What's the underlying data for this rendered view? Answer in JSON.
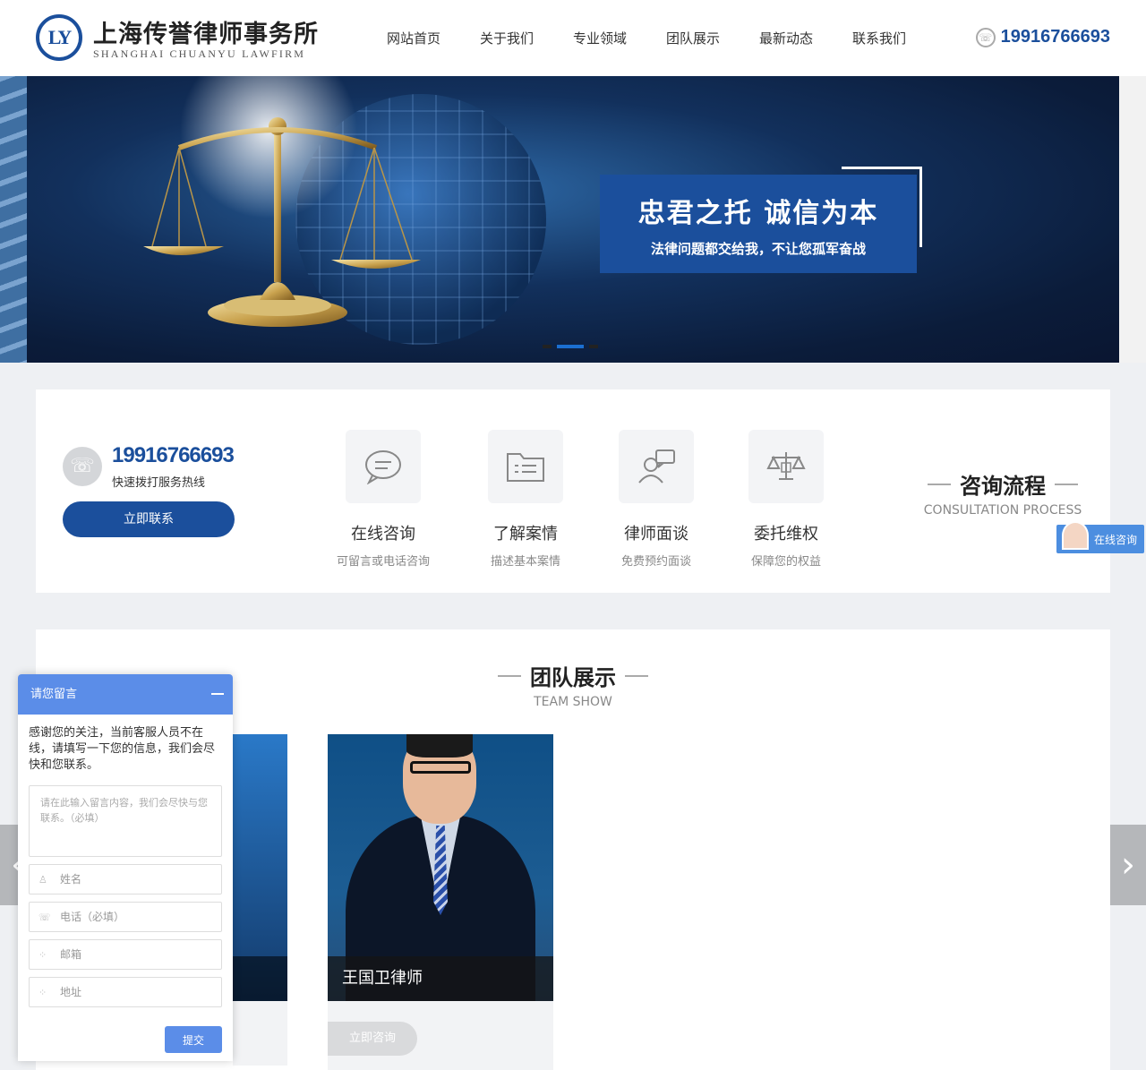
{
  "header": {
    "logo_text": "LY",
    "brand_cn": "上海传誉律师事务所",
    "brand_en": "SHANGHAI CHUANYU LAWFIRM",
    "nav": [
      "网站首页",
      "关于我们",
      "专业领域",
      "团队展示",
      "最新动态",
      "联系我们"
    ],
    "phone": "19916766693"
  },
  "banner": {
    "slogan_main": "忠君之托  诚信为本",
    "slogan_sub": "法律问题都交给我，不让您孤军奋战",
    "active_slide": 2,
    "slide_count": 3
  },
  "consult": {
    "phone": "19916766693",
    "phone_sub": "快速拨打服务热线",
    "button": "立即联系",
    "steps": [
      {
        "title": "在线咨询",
        "sub": "可留言或电话咨询",
        "icon": "chat-bubble-icon"
      },
      {
        "title": "了解案情",
        "sub": "描述基本案情",
        "icon": "folder-list-icon"
      },
      {
        "title": "律师面谈",
        "sub": "免费预约面谈",
        "icon": "person-talk-icon"
      },
      {
        "title": "委托维权",
        "sub": "保障您的权益",
        "icon": "balance-scale-icon"
      }
    ],
    "heading": "咨询流程",
    "heading_en": "CONSULTATION PROCESS"
  },
  "online_tab": "在线咨询",
  "team": {
    "heading": "团队展示",
    "heading_en": "TEAM SHOW",
    "members": [
      {
        "name": "王国卫律师",
        "button": "立即咨询"
      }
    ]
  },
  "message_form": {
    "title": "请您留言",
    "intro": "感谢您的关注，当前客服人员不在线，请填写一下您的信息，我们会尽快和您联系。",
    "textarea_placeholder": "请在此输入留言内容，我们会尽快与您联系。（必填）",
    "name_placeholder": "姓名",
    "phone_placeholder": "电话（必填）",
    "email_placeholder": "邮箱",
    "address_placeholder": "地址",
    "submit": "提交"
  },
  "colors": {
    "brand": "#1b4f9c",
    "form_accent": "#5b8de8"
  }
}
